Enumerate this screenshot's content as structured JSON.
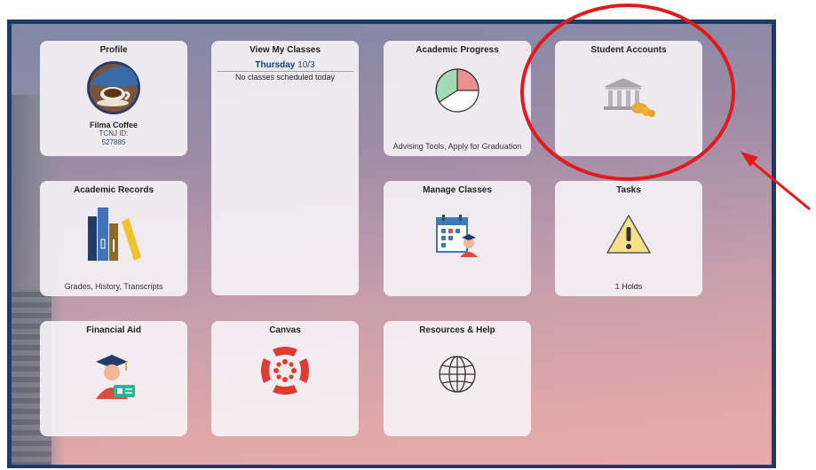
{
  "tiles": {
    "profile": {
      "title": "Profile",
      "name": "Filma Coffee",
      "id_label": "TCNJ ID:",
      "id_value": "527885"
    },
    "classes": {
      "title": "View My Classes",
      "day": "Thursday",
      "date": "10/3",
      "note": "No classes scheduled today"
    },
    "progress": {
      "title": "Academic Progress",
      "footer": "Advising Tools, Apply for Graduation"
    },
    "accounts": {
      "title": "Student Accounts"
    },
    "records": {
      "title": "Academic Records",
      "footer": "Grades, History, Transcripts"
    },
    "manage": {
      "title": "Manage Classes"
    },
    "tasks": {
      "title": "Tasks",
      "count": "1",
      "count_label": "Holds"
    },
    "aid": {
      "title": "Financial Aid"
    },
    "canvas": {
      "title": "Canvas"
    },
    "resources": {
      "title": "Resources & Help"
    }
  },
  "colors": {
    "annotation": "#e11b1b",
    "accent": "#2a4b7c",
    "canvas": "#e03a32"
  },
  "icons": [
    "avatar",
    "pie-chart-icon",
    "bank-icon",
    "books-icon",
    "calendar-icon",
    "warning-icon",
    "graduate-icon",
    "canvas-icon",
    "globe-icon"
  ]
}
